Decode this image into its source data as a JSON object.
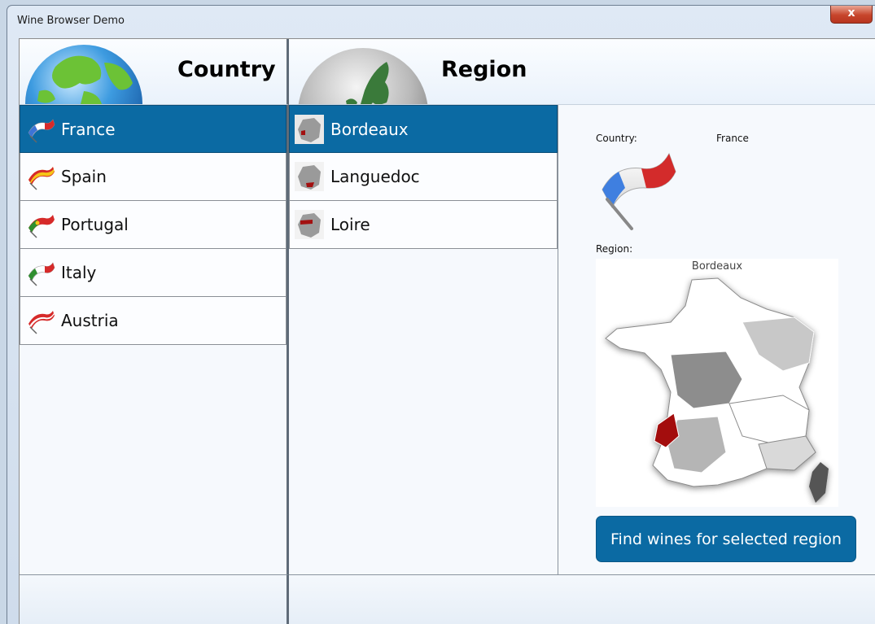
{
  "window": {
    "title": "Wine Browser Demo",
    "close_glyph": "x"
  },
  "country_panel": {
    "header": "Country",
    "items": [
      {
        "label": "France",
        "selected": true,
        "icon": "flag-france-icon"
      },
      {
        "label": "Spain",
        "selected": false,
        "icon": "flag-spain-icon"
      },
      {
        "label": "Portugal",
        "selected": false,
        "icon": "flag-portugal-icon"
      },
      {
        "label": "Italy",
        "selected": false,
        "icon": "flag-italy-icon"
      },
      {
        "label": "Austria",
        "selected": false,
        "icon": "flag-austria-icon"
      }
    ]
  },
  "region_panel": {
    "header": "Region",
    "items": [
      {
        "label": "Bordeaux",
        "selected": true,
        "icon": "region-map-icon"
      },
      {
        "label": "Languedoc",
        "selected": false,
        "icon": "region-map-icon"
      },
      {
        "label": "Loire",
        "selected": false,
        "icon": "region-map-icon"
      }
    ]
  },
  "details": {
    "country_label": "Country:",
    "country_value": "France",
    "region_label": "Region:",
    "map_title": "Bordeaux",
    "find_button": "Find wines for selected region"
  },
  "colors": {
    "selection": "#0b6aa3",
    "highlight_region": "#a31010"
  }
}
